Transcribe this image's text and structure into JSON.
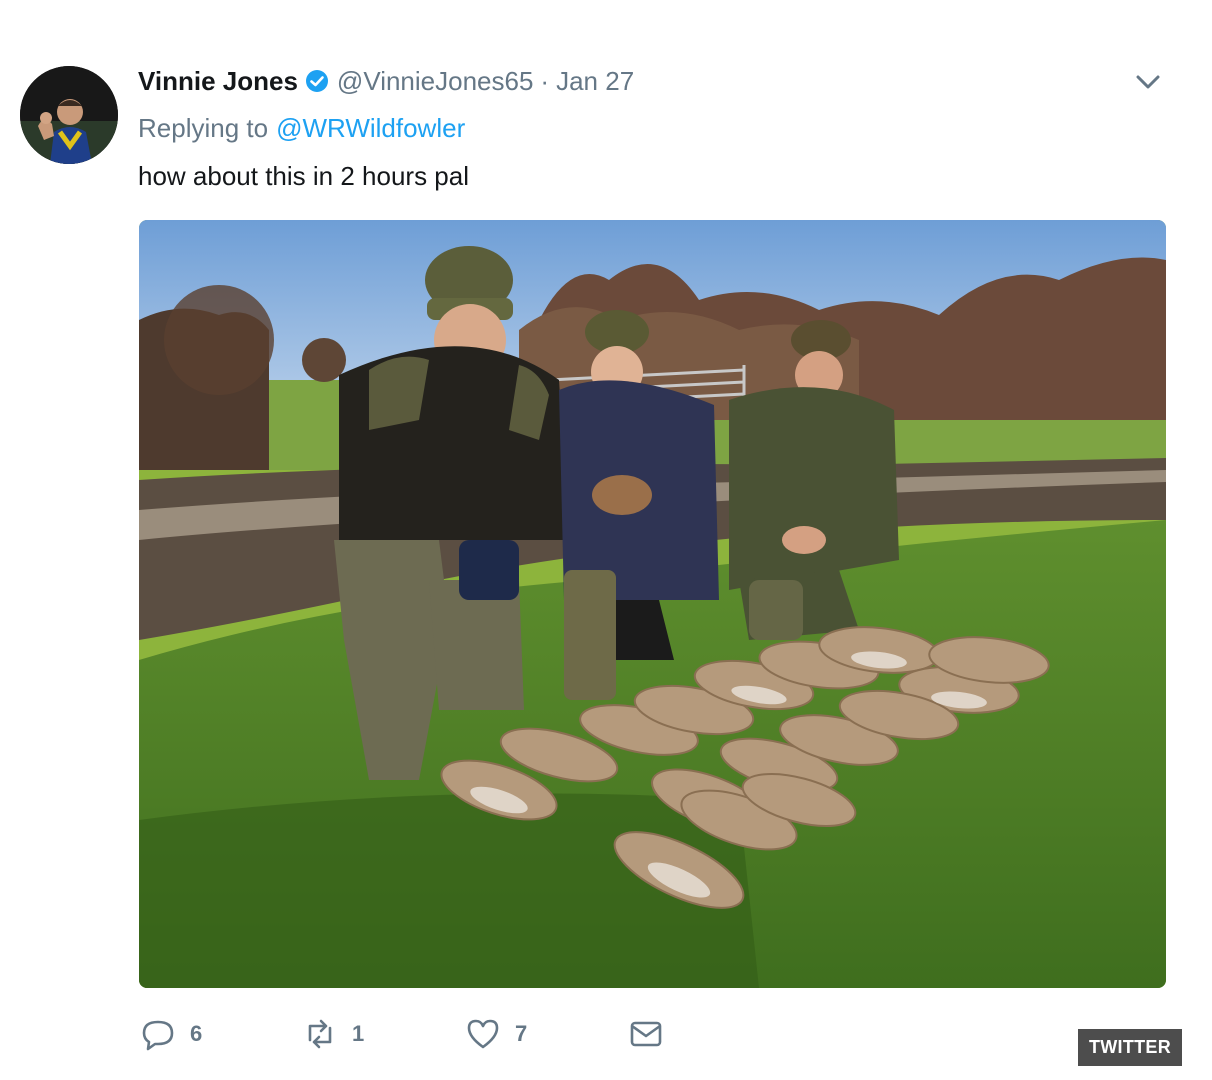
{
  "tweet": {
    "author_name": "Vinnie Jones",
    "handle": "@VinnieJones65",
    "separator": "·",
    "date": "Jan 27",
    "replying_prefix": "Replying to",
    "replying_to": "@WRWildfowler",
    "text": "how about this in 2 hours pal"
  },
  "actions": {
    "replies": "6",
    "retweets": "1",
    "likes": "7"
  },
  "icons": {
    "verified": "verified-badge-icon",
    "menu": "chevron-down-icon",
    "reply": "reply-icon",
    "retweet": "retweet-icon",
    "like": "heart-icon",
    "message": "envelope-icon"
  },
  "colors": {
    "link": "#1da1f2",
    "muted": "#657786",
    "text": "#14171a"
  },
  "badge": "TWITTER"
}
